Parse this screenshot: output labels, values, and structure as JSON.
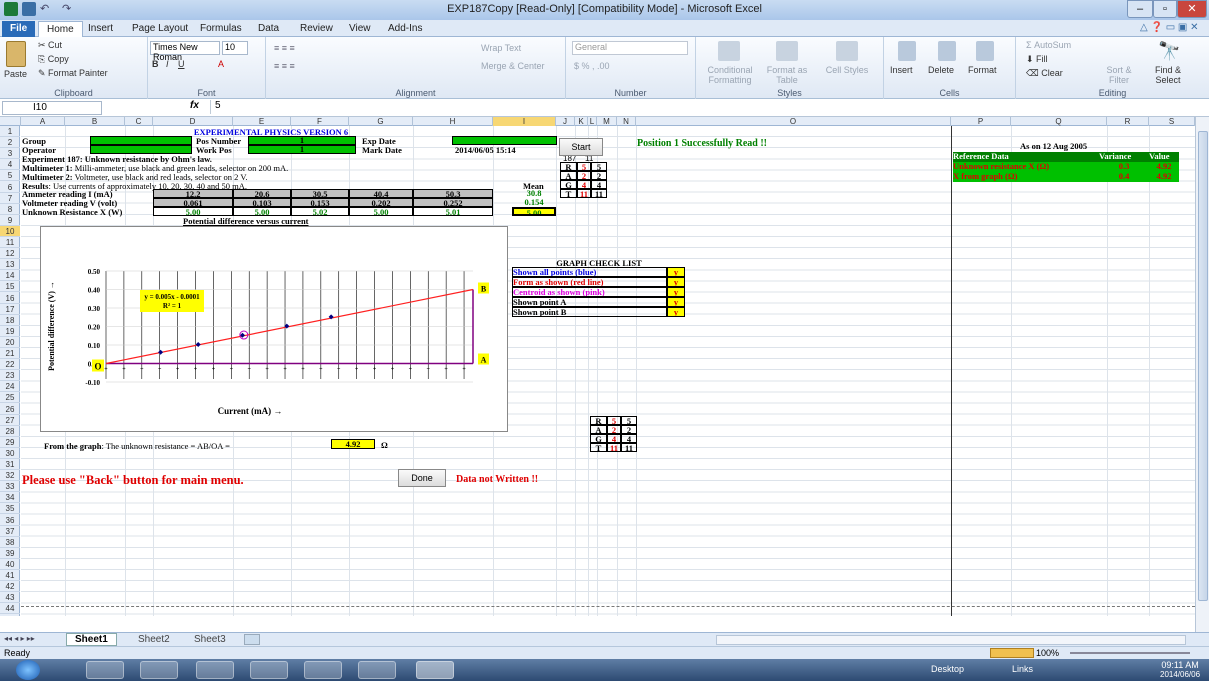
{
  "window": {
    "title": "EXP187Copy [Read-Only] [Compatibility Mode] - Microsoft Excel"
  },
  "tabs": [
    "File",
    "Home",
    "Insert",
    "Page Layout",
    "Formulas",
    "Data",
    "Review",
    "View",
    "Add-Ins"
  ],
  "ribbon": {
    "clipboard": {
      "label": "Clipboard",
      "paste": "Paste",
      "cut": "Cut",
      "copy": "Copy",
      "format_painter": "Format Painter"
    },
    "font": {
      "label": "Font",
      "name": "Times New Roman",
      "size": "10"
    },
    "alignment": {
      "label": "Alignment",
      "wrap": "Wrap Text",
      "merge": "Merge & Center"
    },
    "number": {
      "label": "Number",
      "format": "General"
    },
    "styles": {
      "label": "Styles",
      "cond": "Conditional Formatting",
      "table": "Format as Table",
      "cell": "Cell Styles"
    },
    "cells": {
      "label": "Cells",
      "insert": "Insert",
      "delete": "Delete",
      "format": "Format"
    },
    "editing": {
      "label": "Editing",
      "autosum": "AutoSum",
      "fill": "Fill",
      "clear": "Clear",
      "sort": "Sort & Filter",
      "find": "Find & Select"
    }
  },
  "formula_bar": {
    "name_box": "I10",
    "fx": "fx",
    "value": "5"
  },
  "columns": [
    "A",
    "B",
    "C",
    "D",
    "E",
    "F",
    "G",
    "H",
    "I",
    "J",
    "K",
    "L",
    "M",
    "N",
    "O",
    "P",
    "Q",
    "R",
    "S"
  ],
  "rows": [
    "1",
    "2",
    "3",
    "4",
    "5",
    "6",
    "7",
    "8",
    "9",
    "10",
    "11",
    "12",
    "13",
    "14",
    "15",
    "16",
    "17",
    "18",
    "19",
    "20",
    "21",
    "22",
    "23",
    "24",
    "25",
    "26",
    "27",
    "28",
    "29",
    "30",
    "31",
    "32",
    "33",
    "34",
    "35",
    "36",
    "37",
    "38",
    "39",
    "40",
    "41",
    "42",
    "43",
    "44"
  ],
  "sheet": {
    "title": "EXPERIMENTAL PHYSICS VERSION 6",
    "group_label": "Group",
    "pos_number_label": "Pos Number",
    "pos_number": "1",
    "exp_date_label": "Exp Date",
    "operator_label": "Operator",
    "work_pos_label": "Work Pos",
    "work_pos": "1",
    "mark_date_label": "Mark Date",
    "mark_date": "2014/06/05 15:14",
    "experiment": "Experiment 187: Unknown resistance by Ohm's law.",
    "exp_num": "187",
    "exp_sub": "11",
    "mm1_bold": "Multimeter 1:",
    "mm1_text": " Milli-ammeter, use black and green leads, selector on 200 mA.",
    "mm2_bold": "Multimeter 2:",
    "mm2_text": " Voltmeter, use black and red leads, selector on 2 V.",
    "results_bold": "Results",
    "results_text": ": Use currents of approximately 10, 20, 30, 40 and 50 mA.",
    "mean_label": "Mean",
    "ammeter_label": "Ammeter reading I (mA)",
    "ammeter": [
      "12.2",
      "20.6",
      "30.5",
      "40.4",
      "50.3"
    ],
    "ammeter_mean": "30.8",
    "volt_label": "Voltmeter reading V (volt)",
    "volt": [
      "0.061",
      "0.103",
      "0.153",
      "0.202",
      "0.252"
    ],
    "volt_mean": "0.154",
    "res_label": "Unknown Resistance X (W)",
    "res": [
      "5.00",
      "5.00",
      "5.02",
      "5.00",
      "5.01"
    ],
    "res_mean": "5.00",
    "rag": [
      {
        "k": "R",
        "a": "5",
        "b": "5"
      },
      {
        "k": "A",
        "a": "2",
        "b": "2"
      },
      {
        "k": "G",
        "a": "4",
        "b": "4"
      },
      {
        "k": "T",
        "a": "11",
        "b": "11"
      }
    ],
    "start_btn": "Start",
    "position_msg": "Position 1 Successfully Read !!",
    "chart_title": "Potential difference versus current",
    "graph_check": {
      "title": "GRAPH CHECK LIST",
      "items": [
        {
          "t": "Shown all points (blue)",
          "v": "y",
          "c": "#0000e0"
        },
        {
          "t": "Form as shown (red line)",
          "v": "y",
          "c": "#e00000"
        },
        {
          "t": "Centroid as shown (pink)",
          "v": "y",
          "c": "#e000e0"
        },
        {
          "t": "Shown point A",
          "v": "y",
          "c": "#000000"
        },
        {
          "t": "Shown point B",
          "v": "y",
          "c": "#000000"
        }
      ]
    },
    "from_graph_bold": "From the graph",
    "from_graph_text": ": The unknown resistance = AB/OA =",
    "from_graph_value": "4.92",
    "ohm": "Ω",
    "back_msg": "Please use \"Back\" button for main menu.",
    "done_btn": "Done",
    "not_written": "Data not Written !!",
    "as_on": "As on 12 Aug 2005",
    "ref_header": "Reference Data",
    "variance_header": "Variance",
    "value_header": "Value",
    "ref_rows": [
      {
        "name": "Unknown resistance X (Ω)",
        "variance": "0.3",
        "value": "4.92"
      },
      {
        "name": "X from graph (Ω)",
        "variance": "0.4",
        "value": "4.92"
      }
    ]
  },
  "chart_data": {
    "type": "scatter",
    "title": "",
    "xlabel": "Current (mA) →",
    "ylabel": "Potential difference (V) →",
    "x": [
      12.2,
      20.6,
      30.5,
      40.4,
      50.3
    ],
    "y": [
      0.061,
      0.103,
      0.153,
      0.202,
      0.252
    ],
    "centroid": {
      "x": 30.8,
      "y": 0.154
    },
    "fit_label": "y = 0.005x - 0.0001",
    "r2_label": "R² = 1",
    "yticks": [
      "0.50",
      "0.40",
      "0.30",
      "0.20",
      "0.10",
      "0.00",
      "-0.10"
    ],
    "ylim": [
      -0.1,
      0.5
    ],
    "xlim": [
      0,
      82
    ],
    "point_labels": {
      "O": "O",
      "A": "A",
      "B": "B"
    },
    "colors": {
      "points": "#000080",
      "line": "#ff2020",
      "centroid": "#c000c0",
      "axis": "#800080"
    }
  },
  "sheet_tabs": [
    "Sheet1",
    "Sheet2",
    "Sheet3"
  ],
  "status": {
    "ready": "Ready",
    "zoom": "100%"
  },
  "taskbar": {
    "desktop": "Desktop",
    "links": "Links",
    "time": "09:11 AM",
    "date": "2014/06/06"
  }
}
